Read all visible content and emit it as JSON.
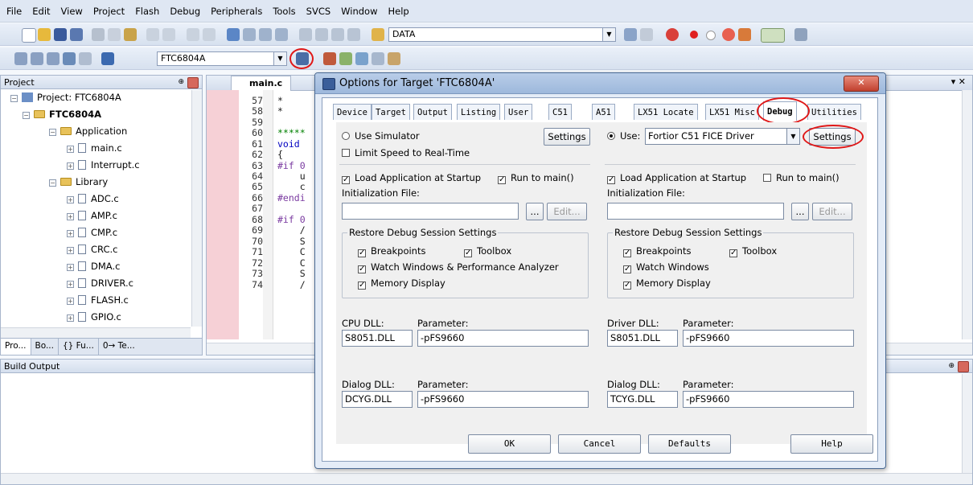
{
  "menu": [
    "File",
    "Edit",
    "View",
    "Project",
    "Flash",
    "Debug",
    "Peripherals",
    "Tools",
    "SVCS",
    "Window",
    "Help"
  ],
  "toolbar": {
    "find_combo": "DATA",
    "target_combo": "FTC6804A"
  },
  "project_pane": {
    "title": "Project",
    "root": "Project: FTC6804A",
    "target": "FTC6804A",
    "groups": [
      {
        "name": "Application",
        "files": [
          "main.c",
          "Interrupt.c"
        ]
      },
      {
        "name": "Library",
        "files": [
          "ADC.c",
          "AMP.c",
          "CMP.c",
          "CRC.c",
          "DMA.c",
          "DRIVER.c",
          "FLASH.c",
          "GPIO.c"
        ]
      }
    ],
    "bottom_tabs": [
      "Pro...",
      "Bo...",
      "{} Fu...",
      "0→ Te..."
    ]
  },
  "editor": {
    "tab": "main.c",
    "lines": [
      {
        "n": "57",
        "code": "*"
      },
      {
        "n": "58",
        "code": "*"
      },
      {
        "n": "59",
        "code": ""
      },
      {
        "n": "60",
        "code": "*****"
      },
      {
        "n": "61",
        "code": "void"
      },
      {
        "n": "62",
        "code": "{"
      },
      {
        "n": "63",
        "code": "#if 0"
      },
      {
        "n": "64",
        "code": "    u"
      },
      {
        "n": "65",
        "code": "    c"
      },
      {
        "n": "66",
        "code": "#endi"
      },
      {
        "n": "67",
        "code": ""
      },
      {
        "n": "68",
        "code": "#if 0"
      },
      {
        "n": "69",
        "code": "    /"
      },
      {
        "n": "70",
        "code": "    S"
      },
      {
        "n": "71",
        "code": "    C"
      },
      {
        "n": "72",
        "code": "    C"
      },
      {
        "n": "73",
        "code": "    S"
      },
      {
        "n": "74",
        "code": "    /"
      }
    ]
  },
  "build_output": {
    "title": "Build Output"
  },
  "dialog": {
    "title": "Options for Target 'FTC6804A'",
    "tabs": [
      "Device",
      "Target",
      "Output",
      "Listing",
      "User",
      "C51",
      "A51",
      "LX51 Locate",
      "LX51 Misc",
      "Debug",
      "Utilities"
    ],
    "active_tab": "Debug",
    "left": {
      "use_simulator": "Use Simulator",
      "settings": "Settings",
      "limit_speed": "Limit Speed to Real-Time",
      "load_app": "Load Application at Startup",
      "run_to_main": "Run to main()",
      "init_file_label": "Initialization File:",
      "browse": "...",
      "edit": "Edit...",
      "restore_group": "Restore Debug Session Settings",
      "breakpoints": "Breakpoints",
      "toolbox": "Toolbox",
      "watch": "Watch Windows & Performance Analyzer",
      "memory": "Memory Display",
      "cpu_dll_label": "CPU DLL:",
      "cpu_dll": "S8051.DLL",
      "param_label": "Parameter:",
      "cpu_param": "-pFS9660",
      "dialog_dll_label": "Dialog DLL:",
      "dialog_dll": "DCYG.DLL",
      "dialog_param": "-pFS9660"
    },
    "right": {
      "use_label": "Use:",
      "driver": "Fortior C51 FICE Driver",
      "settings": "Settings",
      "load_app": "Load Application at Startup",
      "run_to_main": "Run to main()",
      "init_file_label": "Initialization File:",
      "browse": "...",
      "edit": "Edit...",
      "restore_group": "Restore Debug Session Settings",
      "breakpoints": "Breakpoints",
      "toolbox": "Toolbox",
      "watch": "Watch Windows",
      "memory": "Memory Display",
      "driver_dll_label": "Driver DLL:",
      "driver_dll": "S8051.DLL",
      "param_label": "Parameter:",
      "driver_param": "-pFS9660",
      "dialog_dll_label": "Dialog DLL:",
      "dialog_dll": "TCYG.DLL",
      "dialog_param": "-pFS9660"
    },
    "buttons": {
      "ok": "OK",
      "cancel": "Cancel",
      "defaults": "Defaults",
      "help": "Help"
    }
  }
}
